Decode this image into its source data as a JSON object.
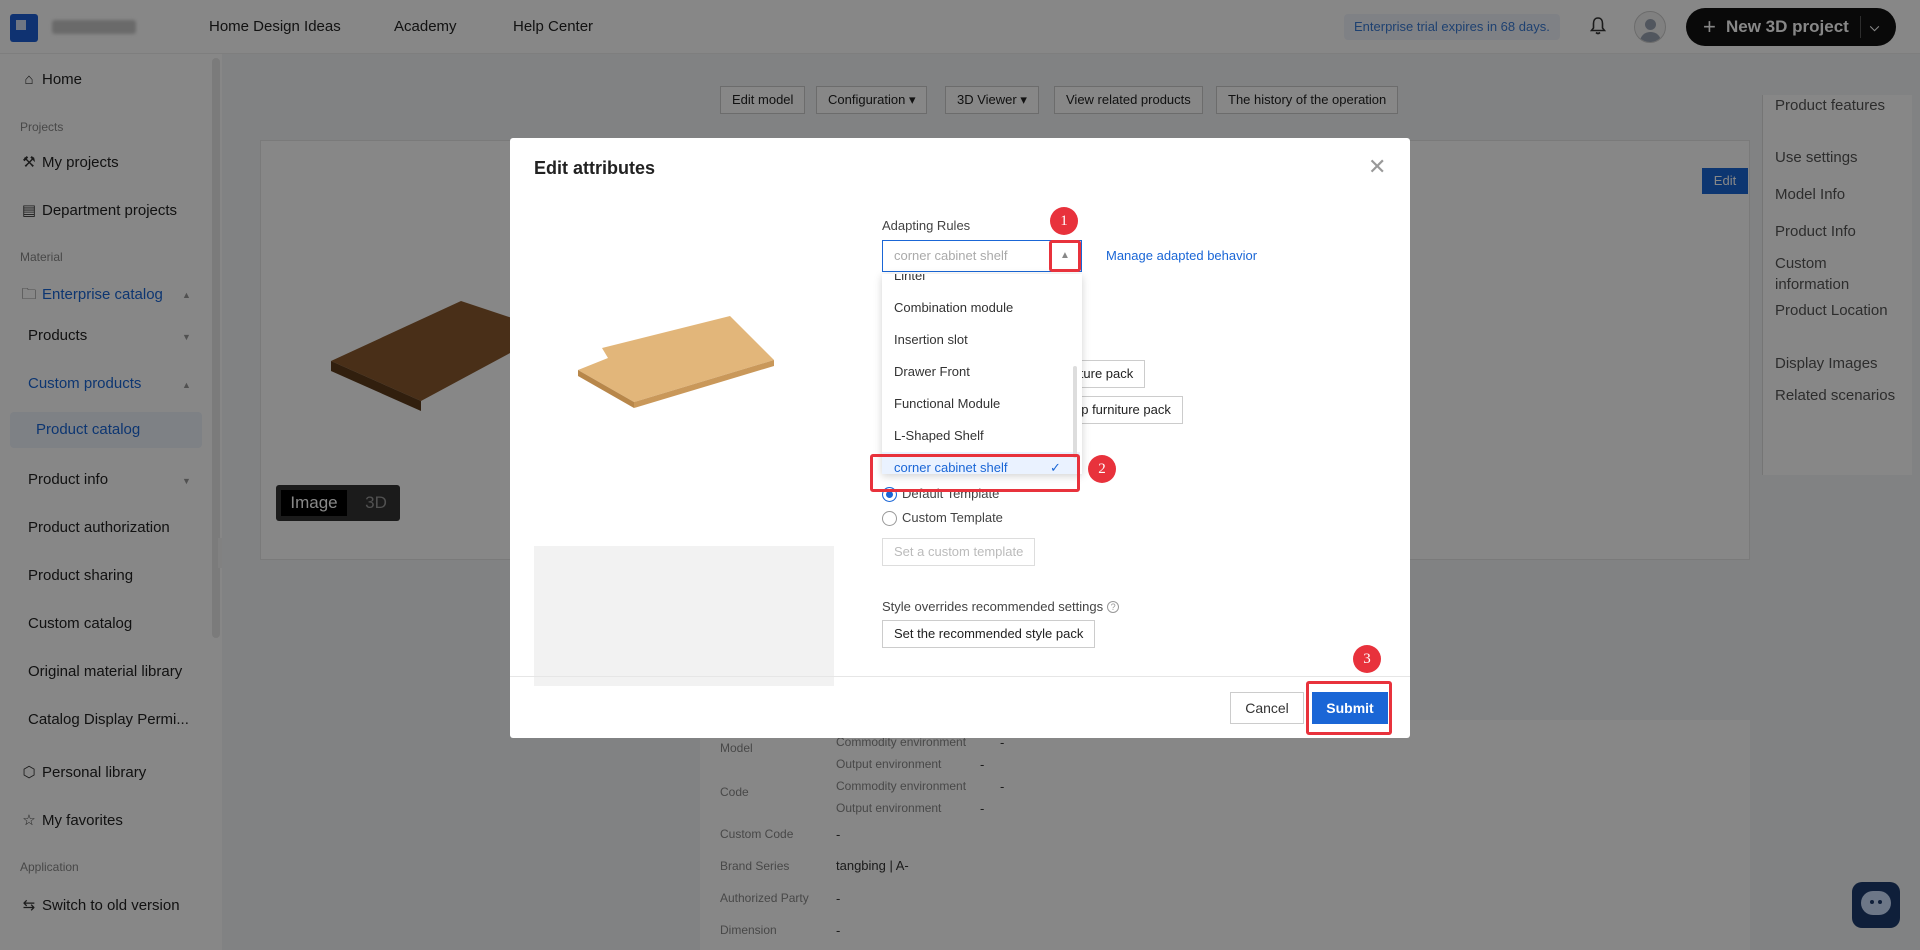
{
  "topbar": {
    "nav": [
      "Home Design Ideas",
      "Academy",
      "Help Center"
    ],
    "trial_text": "Enterprise trial expires in 68 days.",
    "new_project_label": "New 3D project"
  },
  "sidebar": {
    "home": "Home",
    "sec_projects": "Projects",
    "my_projects": "My projects",
    "department_projects": "Department projects",
    "sec_material": "Material",
    "enterprise_catalog": "Enterprise catalog",
    "products": "Products",
    "custom_products": "Custom products",
    "product_catalog": "Product catalog",
    "product_info": "Product info",
    "product_authorization": "Product authorization",
    "product_sharing": "Product sharing",
    "custom_catalog": "Custom catalog",
    "original_material_library": "Original material library",
    "catalog_display": "Catalog Display Permi...",
    "personal_library": "Personal library",
    "my_favorites": "My favorites",
    "sec_application": "Application",
    "switch_old": "Switch to old version"
  },
  "toolbar": {
    "edit_model": "Edit model",
    "configuration": "Configuration",
    "viewer": "3D Viewer",
    "view_related": "View related products",
    "history": "The history of the operation",
    "edit": "Edit"
  },
  "view_toggle": {
    "image": "Image",
    "three_d": "3D"
  },
  "right_nav": [
    "Product features",
    "Use settings",
    "Model Info",
    "Product Info",
    "Custom information",
    "Product Location",
    "Display Images",
    "Related scenarios"
  ],
  "details": {
    "model_label": "Model",
    "code_label": "Code",
    "commodity_env": "Commodity environment",
    "output_env": "Output environment",
    "dash": "-",
    "custom_code_label": "Custom Code",
    "brand_series_label": "Brand Series",
    "brand_series_value": "tangbing | A-",
    "authorized_party_label": "Authorized Party",
    "dimension_label": "Dimension"
  },
  "modal": {
    "title": "Edit attributes",
    "adapting_rules_label": "Adapting Rules",
    "select_placeholder": "corner cabinet shelf",
    "manage_link": "Manage adapted behavior",
    "dropdown_options": [
      "Lintel",
      "Combination module",
      "Insertion slot",
      "Drawer Front",
      "Functional Module",
      "L-Shaped Shelf",
      "corner cabinet shelf"
    ],
    "selected_option": "corner cabinet shelf",
    "furniture_pack_btn": "iiture pack",
    "group_furniture_pack_btn": "up furniture pack",
    "default_template": "Default Template",
    "custom_template": "Custom Template",
    "set_custom_template": "Set a custom template",
    "style_overrides_label": "Style overrides recommended settings",
    "set_style_pack": "Set the recommended style pack",
    "cancel": "Cancel",
    "submit": "Submit"
  },
  "annotations": {
    "badge1": "1",
    "badge2": "2",
    "badge3": "3"
  },
  "colors": {
    "accent": "#1a66d6",
    "annotation": "#e8323c",
    "overlay": "#000000"
  }
}
